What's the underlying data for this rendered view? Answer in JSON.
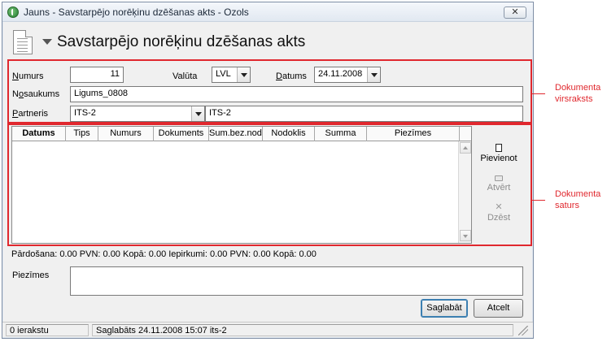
{
  "window": {
    "title": "Jauns - Savstarpējo norēķinu dzēšanas akts - Ozols",
    "close_glyph": "✕"
  },
  "header": {
    "title": "Savstarpējo norēķinu dzēšanas akts"
  },
  "doc_header": {
    "numurs_label": "Numurs",
    "numurs_value": "11",
    "valuta_label": "Valūta",
    "valuta_value": "LVL",
    "datums_label": "Datums",
    "datums_value": "24.11.2008",
    "nosaukums_label": "Nosaukums",
    "nosaukums_value": "Ligums_0808",
    "partneris_label": "Partneris",
    "partneris_code": "ITS-2",
    "partneris_name": "ITS-2"
  },
  "grid": {
    "columns": [
      "Datums",
      "Tips",
      "Numurs",
      "Dokuments",
      "Sum.bez.nod.",
      "Nodoklis",
      "Summa",
      "Piezīmes"
    ]
  },
  "actions": {
    "add": "Pievienot",
    "open": "Atvērt",
    "delete": "Dzēst",
    "delete_glyph": "✕"
  },
  "summary": "Pārdošana: 0.00 PVN: 0.00 Kopā: 0.00 Iepirkumi: 0.00 PVN: 0.00 Kopā: 0.00",
  "notes": {
    "label": "Piezīmes",
    "value": ""
  },
  "buttons": {
    "save": "Saglabāt",
    "cancel": "Atcelt"
  },
  "status": {
    "records": "0 ierakstu",
    "message": "Saglabāts 24.11.2008 15:07 its-2"
  },
  "annotations": {
    "header_line1": "Dokumenta",
    "header_line2": "virsraksts",
    "content_line1": "Dokumenta",
    "content_line2": "saturs",
    "color": "#e0282e"
  }
}
